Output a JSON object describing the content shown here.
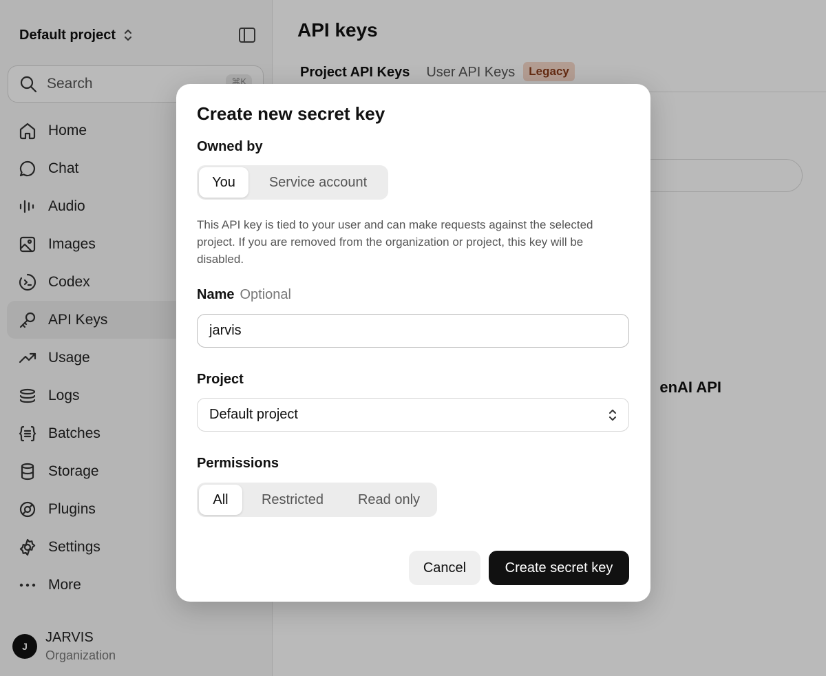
{
  "sidebar": {
    "project_name": "Default project",
    "search": {
      "placeholder": "Search",
      "shortcut": "⌘K"
    },
    "items": [
      {
        "label": "Home",
        "icon": "home-icon"
      },
      {
        "label": "Chat",
        "icon": "chat-icon"
      },
      {
        "label": "Audio",
        "icon": "audio-icon"
      },
      {
        "label": "Images",
        "icon": "image-icon"
      },
      {
        "label": "Codex",
        "icon": "codex-icon"
      },
      {
        "label": "API Keys",
        "icon": "key-icon",
        "active": true
      },
      {
        "label": "Usage",
        "icon": "trending-up-icon"
      },
      {
        "label": "Logs",
        "icon": "logs-icon"
      },
      {
        "label": "Batches",
        "icon": "braces-icon"
      },
      {
        "label": "Storage",
        "icon": "database-icon"
      },
      {
        "label": "Plugins",
        "icon": "plugin-icon"
      },
      {
        "label": "Settings",
        "icon": "gear-icon"
      },
      {
        "label": "More",
        "icon": "more-icon"
      }
    ],
    "org": {
      "avatar_letter": "J",
      "name": "JARVIS",
      "subtitle": "Organization"
    }
  },
  "main": {
    "title": "API keys",
    "tabs": [
      {
        "label": "Project API Keys",
        "active": true
      },
      {
        "label": "User API Keys",
        "active": false
      }
    ],
    "legacy_badge": "Legacy",
    "bg_heading_fragment": "enAI API"
  },
  "modal": {
    "title": "Create new secret key",
    "owned_by": {
      "label": "Owned by",
      "options": [
        "You",
        "Service account"
      ],
      "selected": "You"
    },
    "description": "This API key is tied to your user and can make requests against the selected project. If you are removed from the organization or project, this key will be disabled.",
    "name": {
      "label": "Name",
      "optional": "Optional",
      "value": "jarvis"
    },
    "project": {
      "label": "Project",
      "value": "Default project"
    },
    "permissions": {
      "label": "Permissions",
      "options": [
        "All",
        "Restricted",
        "Read only"
      ],
      "selected": "All"
    },
    "cancel_label": "Cancel",
    "create_label": "Create secret key"
  },
  "colors": {
    "accent": "#111111",
    "overlay": "#000000",
    "legacy_bg": "#f6d7c9",
    "legacy_text": "#8a3b1a"
  }
}
